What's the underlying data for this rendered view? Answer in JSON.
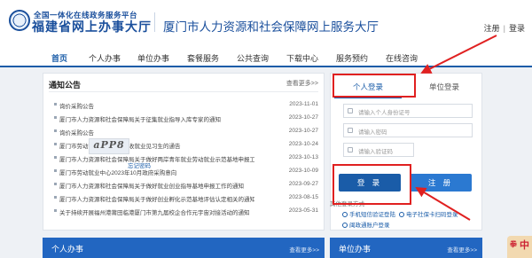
{
  "header": {
    "platform_small": "全国一体化在线政务服务平台",
    "platform_big": "福建省网上办事大厅",
    "site_title": "厦门市人力资源和社会保障网上服务大厅",
    "register_link": "注册",
    "login_link": "登录"
  },
  "nav": {
    "items": [
      {
        "label": "首页"
      },
      {
        "label": "个人办事"
      },
      {
        "label": "单位办事"
      },
      {
        "label": "套餐服务"
      },
      {
        "label": "公共查询"
      },
      {
        "label": "下载中心"
      },
      {
        "label": "服务预约"
      },
      {
        "label": "在线咨询"
      }
    ]
  },
  "notice": {
    "title": "通知公告",
    "more": "查看更多>>",
    "rows": [
      {
        "title": "询价采购公告",
        "date": "2023-11-01"
      },
      {
        "title": "厦门市人力资源和社会保障局关于征集就业指导入库专家的通知",
        "date": "2023-10-27"
      },
      {
        "title": "询价采购公告",
        "date": "2023-10-27"
      },
      {
        "title": "厦门市劳动就业中心关于招收就业见习生的通告",
        "date": "2023-10-24"
      },
      {
        "title": "厦门市人力资源和社会保障局关于做好两岸青年就业劳动就业示范基地申报工作的通知",
        "date": "2023-10-13"
      },
      {
        "title": "厦门市劳动就业中心2023年10月政府采购意向",
        "date": "2023-10-09"
      },
      {
        "title": "厦门市人力资源和社会保障局关于做好就业创业指导基地申报工作的通知",
        "date": "2023-09-27"
      },
      {
        "title": "厦门市人力资源和社会保障局关于做好创业孵化示范基地评估认定相关的通知",
        "date": "2023-08-15"
      },
      {
        "title": "关于持续开展福州港莆田临港厦门市第九届校企合作元宇宙对接活动的通知",
        "date": "2023-05-31"
      }
    ]
  },
  "login": {
    "tab_personal": "个人登录",
    "tab_unit": "单位登录",
    "id_placeholder": "请输入个人身份证号",
    "password_placeholder": "请输入密码",
    "captcha_placeholder": "请输入验证码",
    "captcha_text": "aPP8",
    "forgot": "忘记密码",
    "login_button": "登 录",
    "register_button": "注 册",
    "other_title": "其他登录方式",
    "other_methods": [
      {
        "label": "手机短信验证登陆"
      },
      {
        "label": "电子社保卡扫码登录"
      },
      {
        "label": "闽政通账户登录"
      }
    ]
  },
  "panels": {
    "personal": {
      "title": "个人办事",
      "more": "查看更多>>"
    },
    "unit": {
      "title": "单位办事",
      "more": "查看更多>>"
    }
  },
  "side_widget": {
    "char1": "拳",
    "char2": "中"
  },
  "colors": {
    "brand": "#1a5ca8",
    "highlight": "#e02020"
  }
}
